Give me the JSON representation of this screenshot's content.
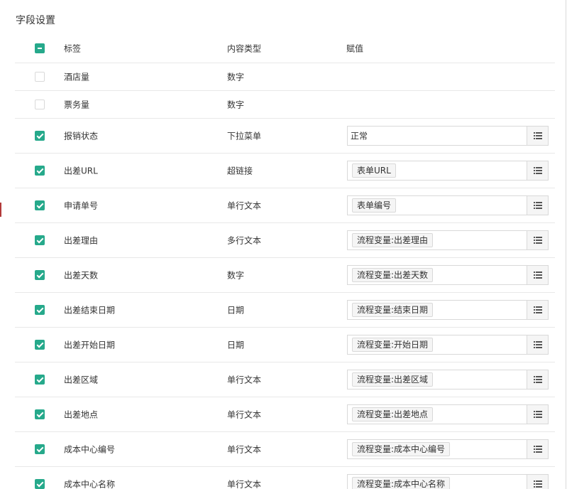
{
  "section_title": "字段设置",
  "columns": {
    "label": "标签",
    "type": "内容类型",
    "value": "赋值"
  },
  "colors": {
    "accent": "#26a98b",
    "border": "#d9d9d9",
    "row_divider": "#e8e8e8"
  },
  "rows": [
    {
      "checked": false,
      "label": "酒店量",
      "type": "数字",
      "value_kind": "none",
      "value": ""
    },
    {
      "checked": false,
      "label": "票务量",
      "type": "数字",
      "value_kind": "none",
      "value": ""
    },
    {
      "checked": true,
      "label": "报销状态",
      "type": "下拉菜单",
      "value_kind": "text",
      "value": "正常"
    },
    {
      "checked": true,
      "label": "出差URL",
      "type": "超链接",
      "value_kind": "tag",
      "value": "表单URL"
    },
    {
      "checked": true,
      "label": "申请单号",
      "type": "单行文本",
      "value_kind": "tag",
      "value": "表单编号"
    },
    {
      "checked": true,
      "label": "出差理由",
      "type": "多行文本",
      "value_kind": "tag",
      "value": "流程变量:出差理由"
    },
    {
      "checked": true,
      "label": "出差天数",
      "type": "数字",
      "value_kind": "tag",
      "value": "流程变量:出差天数"
    },
    {
      "checked": true,
      "label": "出差结束日期",
      "type": "日期",
      "value_kind": "tag",
      "value": "流程变量:结束日期"
    },
    {
      "checked": true,
      "label": "出差开始日期",
      "type": "日期",
      "value_kind": "tag",
      "value": "流程变量:开始日期"
    },
    {
      "checked": true,
      "label": "出差区域",
      "type": "单行文本",
      "value_kind": "tag",
      "value": "流程变量:出差区域"
    },
    {
      "checked": true,
      "label": "出差地点",
      "type": "单行文本",
      "value_kind": "tag",
      "value": "流程变量:出差地点"
    },
    {
      "checked": true,
      "label": "成本中心编号",
      "type": "单行文本",
      "value_kind": "tag",
      "value": "流程变量:成本中心编号"
    },
    {
      "checked": true,
      "label": "成本中心名称",
      "type": "单行文本",
      "value_kind": "tag",
      "value": "流程变量:成本中心名称"
    }
  ],
  "icons": {
    "select_all": "minus-checkbox-icon",
    "checked": "check-icon",
    "picker": "list-icon"
  }
}
